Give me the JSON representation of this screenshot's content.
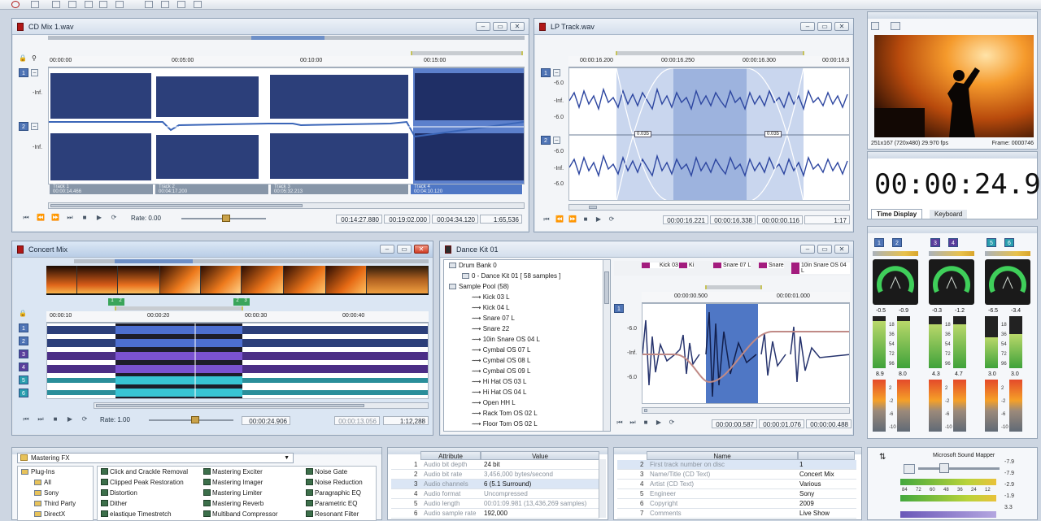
{
  "windows": {
    "cd_mix": {
      "title": "CD Mix 1.wav",
      "ruler": [
        "00:00:00",
        "00:05:00",
        "00:10:00",
        "00:15:00"
      ],
      "db_labels": [
        "-Inf.",
        "-Inf."
      ],
      "regions": [
        {
          "name": "Track 1",
          "time": "00:00:14.466"
        },
        {
          "name": "Track 2",
          "time": "00:04:17.200"
        },
        {
          "name": "Track 3",
          "time": "00:05:32.213"
        },
        {
          "name": "Track 4",
          "time": "00:04:10.120"
        }
      ],
      "rate": "Rate: 0.00",
      "times": [
        "00:14:27.880",
        "00:19:02.000",
        "00:04:34.120",
        "1:65,536"
      ]
    },
    "lp_track": {
      "title": "LP Track.wav",
      "ruler": [
        "00:00:16.200",
        "00:00:16.250",
        "00:00:16.300",
        "00:00:16.3"
      ],
      "db_labels": [
        "-6.0",
        "-Inf.",
        "-6.0",
        "-6.0",
        "-Inf.",
        "-6.0"
      ],
      "fade_labels": [
        "0.035",
        "0.035"
      ],
      "times": [
        "00:00:16.221",
        "00:00:16.338",
        "00:00:00.116",
        "1:17"
      ]
    },
    "concert_mix": {
      "title": "Concert Mix",
      "ruler": [
        "00:00:10",
        "00:00:20",
        "00:00:30",
        "00:00:40"
      ],
      "markers": [
        "1",
        "2",
        "2",
        "3"
      ],
      "tracks": [
        "1",
        "2",
        "3",
        "4",
        "5",
        "6"
      ],
      "rate": "Rate: 1.00",
      "times": [
        "00:00:24.906",
        "00:00:13.056",
        "1:12,288"
      ]
    },
    "dance_kit": {
      "title": "Dance Kit 01",
      "tree": [
        "Drum Bank 0",
        "0 - Dance Kit 01 [ 58 samples ]",
        "Sample Pool (58)",
        "Kick 03 L",
        "Kick 04 L",
        "Snare 07 L",
        "Snare 22",
        "10in Snare OS 04 L",
        "Cymbal OS 07 L",
        "Cymbal OS 08 L",
        "Cymbal OS 09 L",
        "Hi Hat OS 03 L",
        "Hi Hat OS 04 L",
        "Open HH L",
        "Rack Tom OS 02 L",
        "Floor Tom OS 02 L"
      ],
      "markers": [
        "Kick 03",
        "Ki",
        "Snare 07 L",
        "Snare",
        "10in Snare OS 04 L"
      ],
      "ruler": [
        "00:00:00.500",
        "00:00:01.000"
      ],
      "db_labels": [
        "-6.0",
        "-Inf.",
        "-6.0"
      ],
      "times": [
        "00:00:00.587",
        "00:00:01.076",
        "00:00:00.488"
      ]
    }
  },
  "video": {
    "info": "251x167 (720x480)  29.970 fps",
    "frame": "Frame: 0000746"
  },
  "time_display": {
    "time": "00:00:24.906",
    "tabs": [
      "Time Display",
      "Keyboard"
    ]
  },
  "meters": [
    {
      "ch": [
        "1",
        "2"
      ],
      "peaks": [
        "-0.5",
        "-0.9"
      ],
      "levels": [
        "8.9",
        "8.0"
      ],
      "fills": [
        0.9,
        0.9
      ]
    },
    {
      "ch": [
        "3",
        "4"
      ],
      "peaks": [
        "-0.3",
        "-1.2"
      ],
      "levels": [
        "4.3",
        "4.7"
      ],
      "fills": [
        0.85,
        0.85
      ]
    },
    {
      "ch": [
        "5",
        "6"
      ],
      "peaks": [
        "-6.5",
        "-3.4"
      ],
      "levels": [
        "3.0",
        "3.0"
      ],
      "fills": [
        0.6,
        0.65
      ]
    }
  ],
  "meter_scale": [
    "18",
    "36",
    "54",
    "72",
    "96"
  ],
  "meter_scale2": [
    "2",
    "-2",
    "-6",
    "-10"
  ],
  "fx_panel": {
    "dropdown": "Mastering FX",
    "tree": [
      "Plug-Ins",
      "All",
      "Sony",
      "Third Party",
      "DirectX"
    ],
    "col1": [
      "Click and Crackle Removal",
      "Clipped Peak Restoration",
      "Distortion",
      "Dither",
      "elastique Timestretch"
    ],
    "col2": [
      "Mastering Exciter",
      "Mastering Imager",
      "Mastering Limiter",
      "Mastering Reverb",
      "Multiband Compressor"
    ],
    "col3": [
      "Noise Gate",
      "Noise Reduction",
      "Paragraphic EQ",
      "Parametric EQ",
      "Resonant Filter"
    ]
  },
  "attributes": {
    "headers": [
      "Attribute",
      "Value"
    ],
    "rows": [
      {
        "n": "1",
        "attr": "Audio bit depth",
        "val": "24 bit"
      },
      {
        "n": "2",
        "attr": "Audio bit rate",
        "val": "3,456,000 bytes/second"
      },
      {
        "n": "3",
        "attr": "Audio channels",
        "val": "6  (5.1 Surround)"
      },
      {
        "n": "4",
        "attr": "Audio format",
        "val": "Uncompressed"
      },
      {
        "n": "5",
        "attr": "Audio length",
        "val": "00:01:09.981 (13,436,269 samples)"
      },
      {
        "n": "6",
        "attr": "Audio sample rate",
        "val": "192,000"
      }
    ]
  },
  "cd_text": {
    "headers": [
      "Name",
      ""
    ],
    "rows": [
      {
        "n": "2",
        "name": "First track number on disc",
        "val": "1"
      },
      {
        "n": "3",
        "name": "Name/Title (CD Text)",
        "val": "Concert Mix"
      },
      {
        "n": "4",
        "name": "Artist (CD Text)",
        "val": "Various"
      },
      {
        "n": "5",
        "name": "Engineer",
        "val": "Sony"
      },
      {
        "n": "6",
        "name": "Copyright",
        "val": "2009"
      },
      {
        "n": "7",
        "name": "Comments",
        "val": "Live Show"
      }
    ]
  },
  "mixer": {
    "title": "Microsoft Sound Mapper",
    "scale": [
      "-7.9",
      "-7.9",
      "-2.9",
      "-1.9",
      "3.3"
    ],
    "meter_nums": [
      "84",
      "72",
      "60",
      "48",
      "36",
      "24",
      "12"
    ]
  },
  "colors": {
    "wave_blue": "#2c3f7a",
    "sel_blue": "#4f77c5",
    "accent": "#b01818"
  }
}
